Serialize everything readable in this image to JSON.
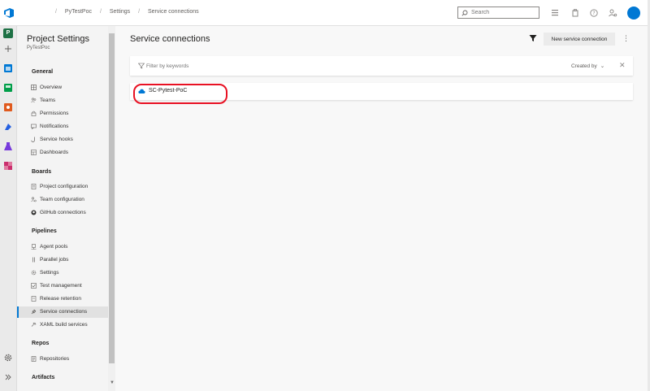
{
  "topbar": {
    "breadcrumbs": [
      "",
      "PyTestPoc",
      "Settings",
      "Service connections"
    ],
    "search_placeholder": "Search",
    "icons": [
      "list-icon",
      "bag-icon",
      "help-icon",
      "user-settings-icon"
    ],
    "avatar_color": "#0078d4"
  },
  "rail": {
    "project_badge": "P",
    "items": [
      "plus-icon",
      "overview-icon",
      "boards-icon",
      "repos-icon",
      "pipelines-icon",
      "test-plans-icon",
      "artifacts-icon"
    ],
    "footer": [
      "gear-icon",
      "expand-icon"
    ]
  },
  "nav": {
    "title": "Project Settings",
    "subtitle": "PyTestPoc",
    "sections": [
      {
        "title": "General",
        "items": [
          "Overview",
          "Teams",
          "Permissions",
          "Notifications",
          "Service hooks",
          "Dashboards"
        ]
      },
      {
        "title": "Boards",
        "items": [
          "Project configuration",
          "Team configuration",
          "GitHub connections"
        ]
      },
      {
        "title": "Pipelines",
        "items": [
          "Agent pools",
          "Parallel jobs",
          "Settings",
          "Test management",
          "Release retention",
          "Service connections",
          "XAML build services"
        ]
      },
      {
        "title": "Repos",
        "items": [
          "Repositories"
        ]
      },
      {
        "title": "Artifacts",
        "items": []
      }
    ],
    "selected": "Service connections"
  },
  "main": {
    "title": "Service connections",
    "new_button": "New service connection",
    "more": "⋮",
    "filter_placeholder": "Filter by keywords",
    "created_by": "Created by",
    "close": "✕",
    "connections": [
      {
        "name": "SC-Pytest-PoC"
      }
    ],
    "accent": "#0078d4",
    "highlight_color": "#e81123"
  }
}
